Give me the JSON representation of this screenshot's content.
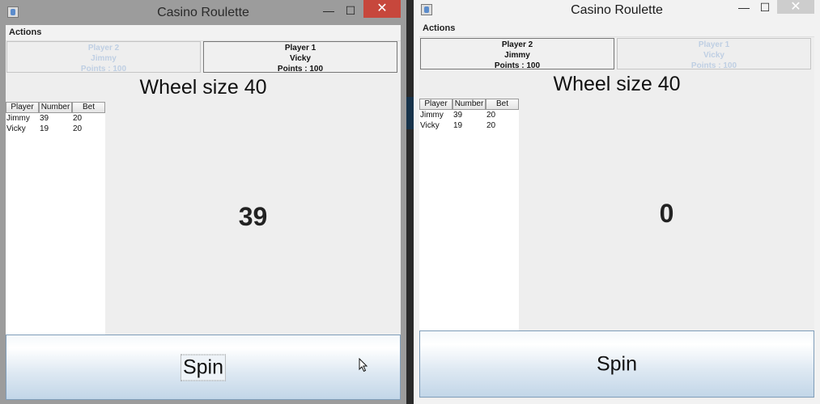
{
  "windows": [
    {
      "title": "Casino Roulette",
      "controls": {
        "minimize": "—",
        "maximize": "☐",
        "close": "✕"
      },
      "menu": "Actions",
      "tabs": [
        {
          "label": "Player 2",
          "name": "Jimmy",
          "points": "Points : 100",
          "active": false
        },
        {
          "label": "Player 1",
          "name": "Vicky",
          "points": "Points : 100",
          "active": true
        }
      ],
      "wheel_label": "Wheel size 40",
      "table": {
        "columns": [
          "Player",
          "Number",
          "Bet"
        ],
        "rows": [
          [
            "Jimmy",
            "39",
            "20"
          ],
          [
            "Vicky",
            "19",
            "20"
          ]
        ]
      },
      "result": "39",
      "spin_label": "Spin"
    },
    {
      "title": "Casino Roulette",
      "controls": {
        "minimize": "—",
        "maximize": "☐",
        "close": "✕"
      },
      "menu": "Actions",
      "tabs": [
        {
          "label": "Player 2",
          "name": "Jimmy",
          "points": "Points : 100",
          "active": true
        },
        {
          "label": "Player 1",
          "name": "Vicky",
          "points": "Points : 100",
          "active": false
        }
      ],
      "wheel_label": "Wheel size 40",
      "table": {
        "columns": [
          "Player",
          "Number",
          "Bet"
        ],
        "rows": [
          [
            "Jimmy",
            "39",
            "20"
          ],
          [
            "Vicky",
            "19",
            "20"
          ]
        ]
      },
      "result": "0",
      "spin_label": "Spin"
    }
  ]
}
